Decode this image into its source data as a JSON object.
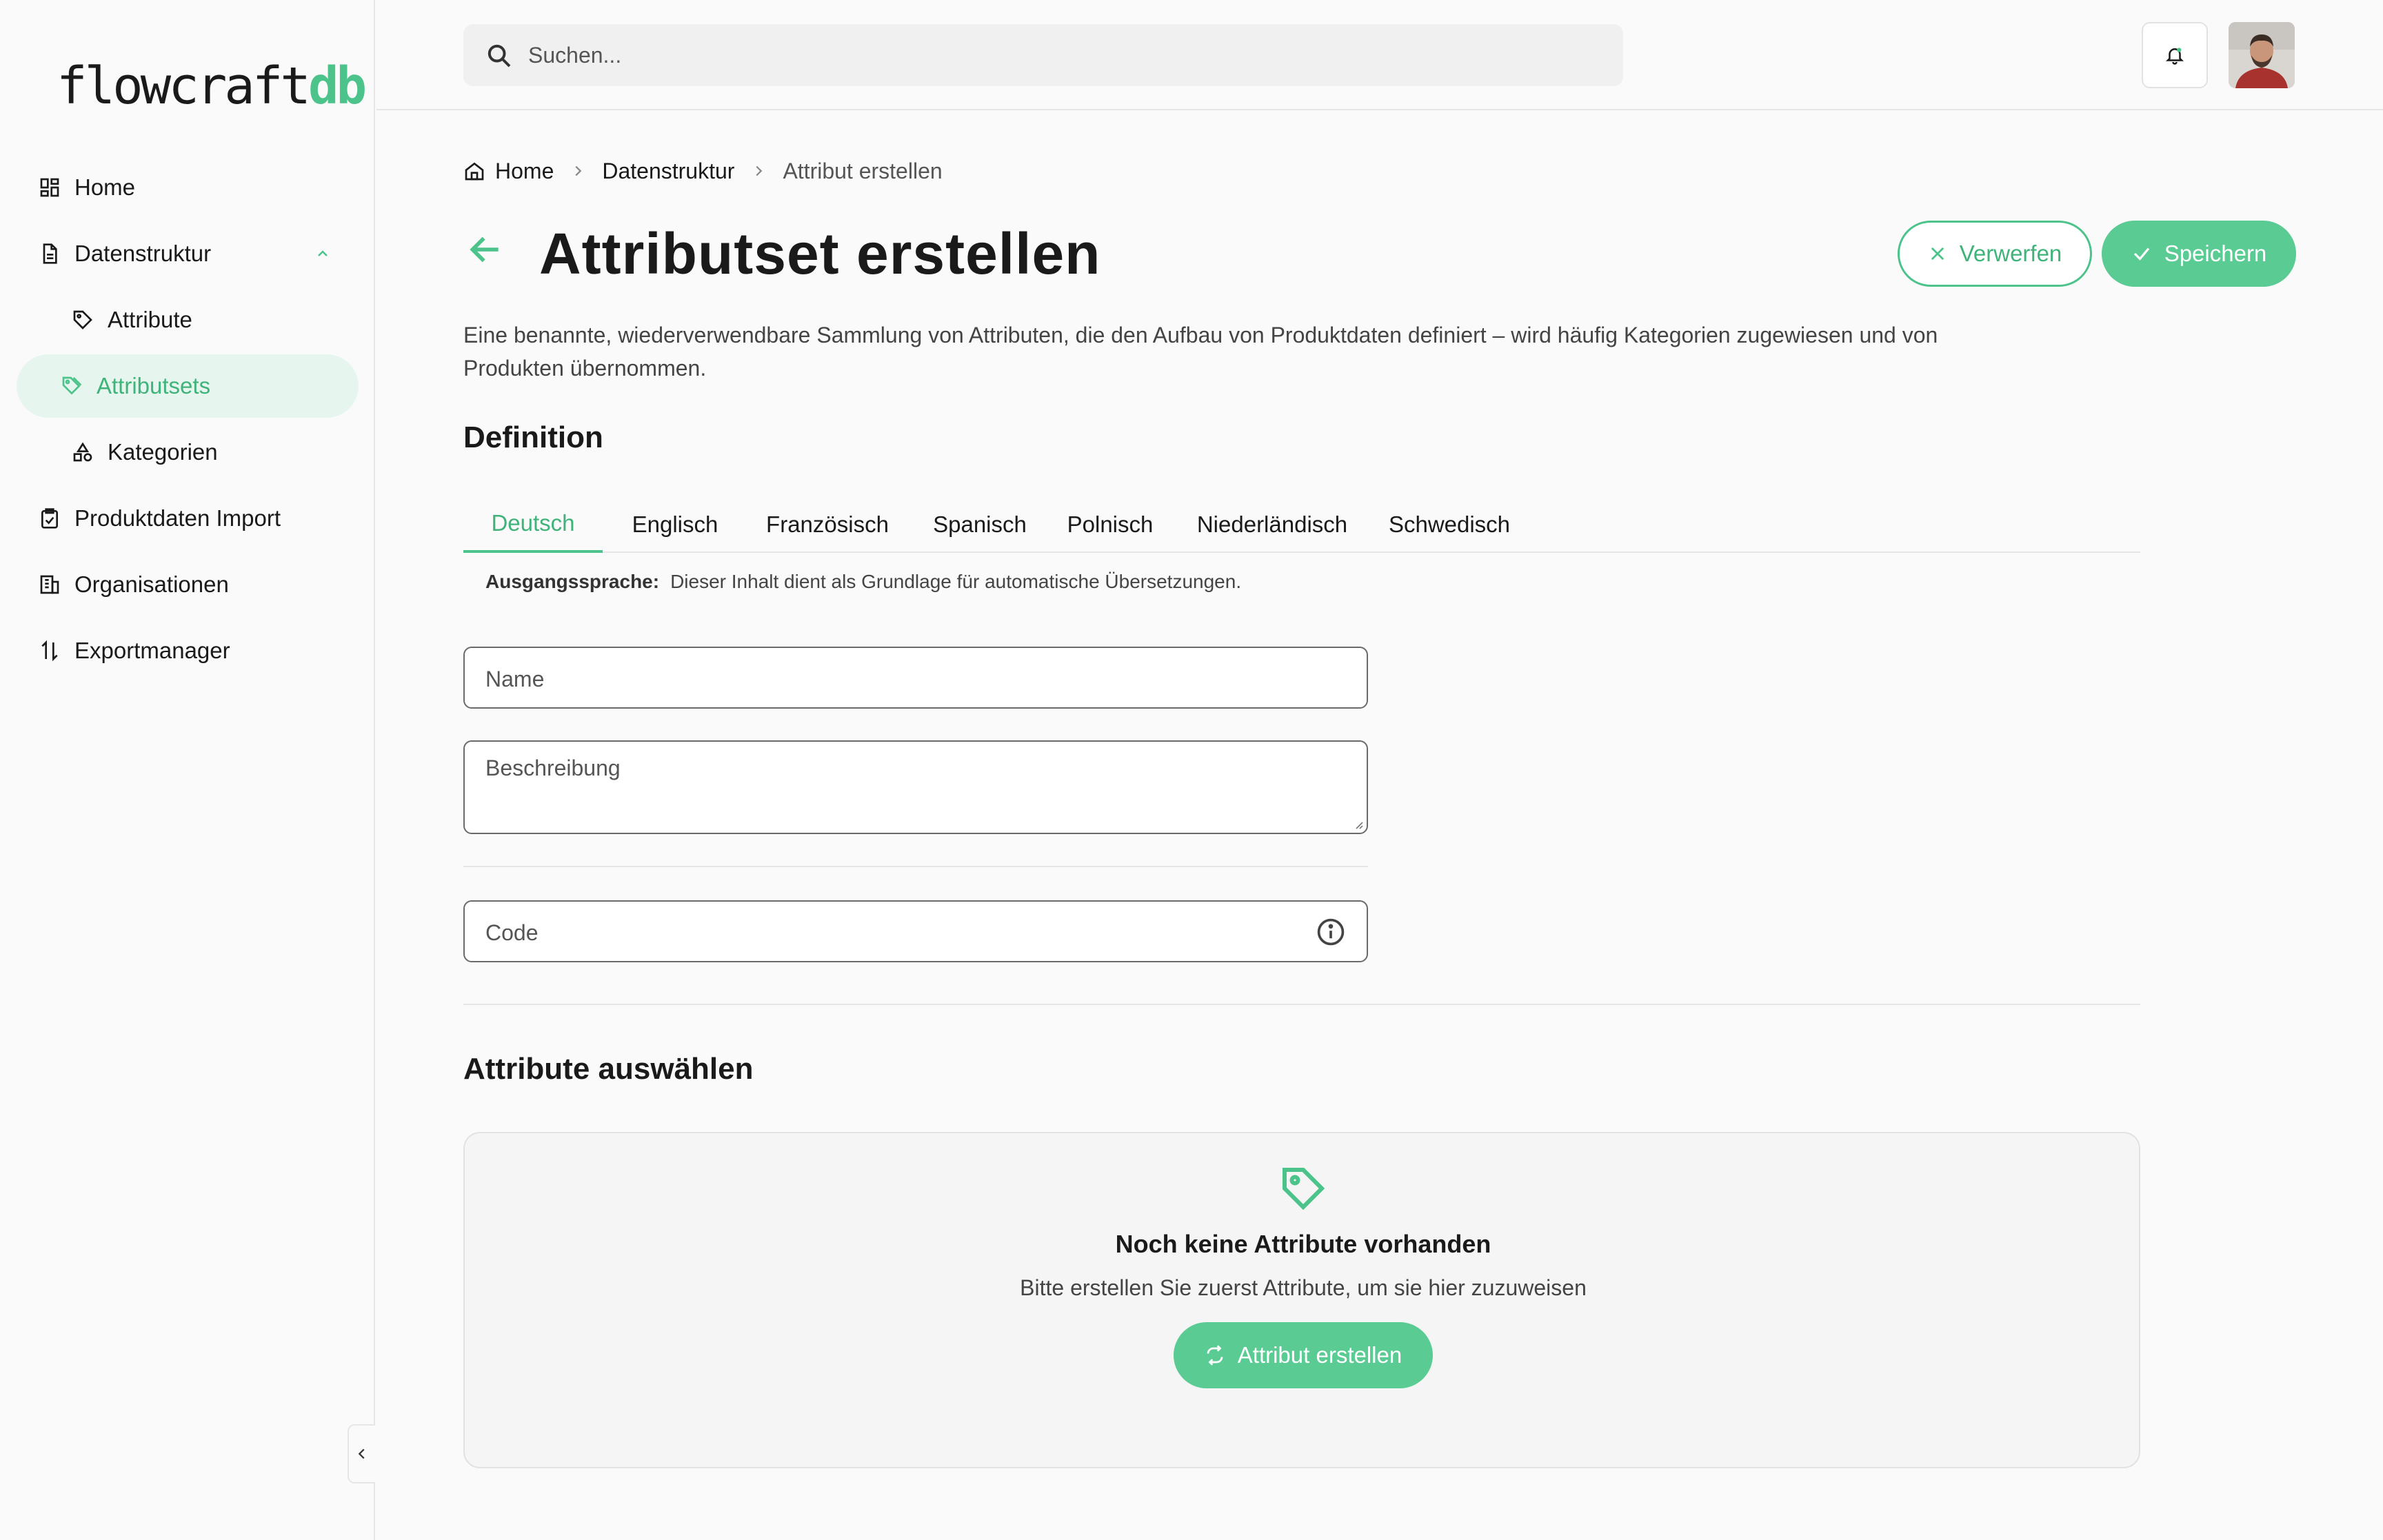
{
  "brand": {
    "logo_main": "flowcraft",
    "logo_accent": "db"
  },
  "search": {
    "placeholder": "Suchen..."
  },
  "sidebar": {
    "items": [
      {
        "label": "Home"
      },
      {
        "label": "Datenstruktur"
      },
      {
        "label": "Attribute"
      },
      {
        "label": "Attributsets"
      },
      {
        "label": "Kategorien"
      },
      {
        "label": "Produktdaten Import"
      },
      {
        "label": "Organisationen"
      },
      {
        "label": "Exportmanager"
      }
    ]
  },
  "breadcrumb": {
    "home": "Home",
    "section": "Datenstruktur",
    "current": "Attribut erstellen"
  },
  "page": {
    "title": "Attributset erstellen",
    "discard_label": "Verwerfen",
    "save_label": "Speichern",
    "description": "Eine benannte, wiederverwendbare Sammlung von Attributen, die den Aufbau von Produktdaten definiert – wird häufig Kategorien zugewiesen und von Produkten übernommen."
  },
  "definition": {
    "heading": "Definition",
    "tabs": [
      "Deutsch",
      "Englisch",
      "Französisch",
      "Spanisch",
      "Polnisch",
      "Niederländisch",
      "Schwedisch"
    ],
    "active_tab": "Deutsch",
    "hint_label": "Ausgangssprache:",
    "hint_text": "Dieser Inhalt dient als Grundlage für automatische Übersetzungen.",
    "name_placeholder": "Name",
    "description_placeholder": "Beschreibung",
    "code_placeholder": "Code"
  },
  "attributes": {
    "heading": "Attribute auswählen",
    "empty_title": "Noch keine Attribute vorhanden",
    "empty_sub": "Bitte erstellen Sie zuerst Attribute, um sie hier zuzuweisen",
    "create_label": "Attribut erstellen"
  },
  "colors": {
    "accent": "#4cc38a",
    "accent_bg": "#e6f6ee",
    "text": "#1a1a1a"
  }
}
